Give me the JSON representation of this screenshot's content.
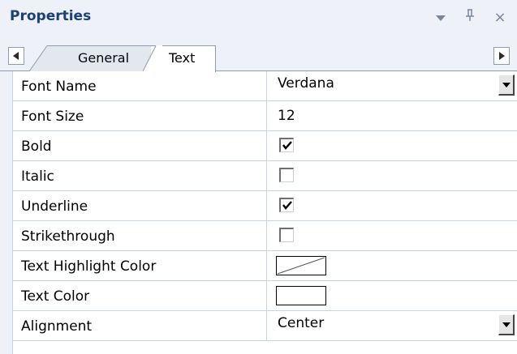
{
  "panel": {
    "title": "Properties",
    "pin_glyph": "ṇ",
    "close_glyph": "×"
  },
  "tabs": {
    "items": [
      {
        "label": "General",
        "active": false
      },
      {
        "label": "Text",
        "active": true
      }
    ]
  },
  "icons": {
    "dropdown": "chevron-down-icon",
    "pin": "pin-icon",
    "close": "close-icon",
    "scroll_left": "triangle-left-icon",
    "scroll_right": "triangle-right-icon",
    "checkmark": "checkmark-icon"
  },
  "properties": [
    {
      "name": "Font Name",
      "type": "combo",
      "value": "Verdana"
    },
    {
      "name": "Font Size",
      "type": "text",
      "value": "12"
    },
    {
      "name": "Bold",
      "type": "checkbox",
      "checked": true
    },
    {
      "name": "Italic",
      "type": "checkbox",
      "checked": false
    },
    {
      "name": "Underline",
      "type": "checkbox",
      "checked": true
    },
    {
      "name": "Strikethrough",
      "type": "checkbox",
      "checked": false
    },
    {
      "name": "Text Highlight Color",
      "type": "color",
      "value": "none"
    },
    {
      "name": "Text Color",
      "type": "color",
      "value": "#ffffff"
    },
    {
      "name": "Alignment",
      "type": "combo",
      "value": "Center"
    }
  ],
  "colors": {
    "title": "#1b3f7a",
    "grid_line": "#c7d3e6",
    "background": "#eef2f8"
  }
}
